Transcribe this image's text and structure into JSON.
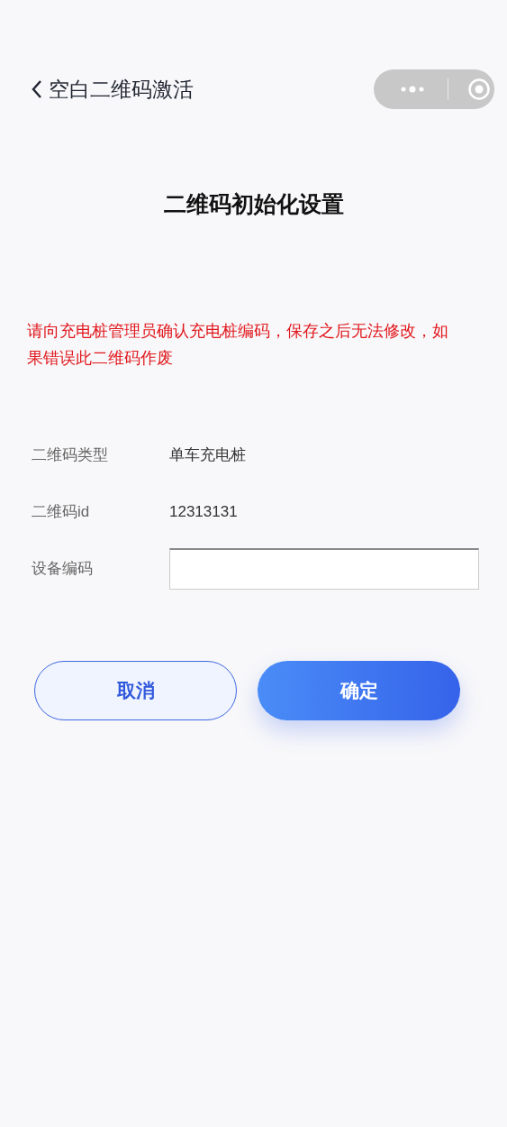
{
  "nav": {
    "title": "空白二维码激活"
  },
  "heading": "二维码初始化设置",
  "warning": "请向充电桩管理员确认充电桩编码，保存之后无法修改，如果错误此二维码作废",
  "fields": [
    {
      "kind": "text",
      "label": "二维码类型",
      "value": "单车充电桩"
    },
    {
      "kind": "text",
      "label": "二维码id",
      "value": "12313131"
    },
    {
      "kind": "input",
      "label": "设备编码"
    }
  ],
  "buttons": [
    {
      "kind": "secondary",
      "label": "取消"
    },
    {
      "kind": "primary",
      "label": "确定"
    }
  ]
}
